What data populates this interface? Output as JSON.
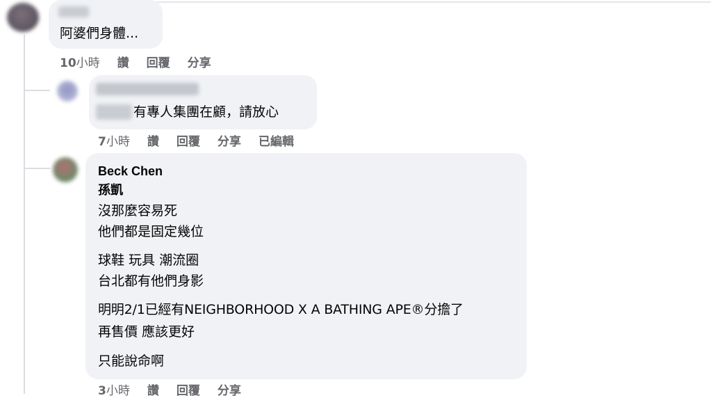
{
  "comments": [
    {
      "author_blurred": true,
      "text_lines": [
        "阿婆們身體..."
      ],
      "time_num": "10",
      "time_unit": "小時",
      "actions": [
        "讚",
        "回覆",
        "分享"
      ]
    },
    {
      "author_blurred": true,
      "mention_blurred": true,
      "text_lines": [
        "有專人集團在顧，請放心"
      ],
      "time_num": "7",
      "time_unit": "小時",
      "actions": [
        "讚",
        "回覆",
        "分享",
        "已編輯"
      ]
    },
    {
      "author": "Beck Chen",
      "mention": "孫凱",
      "text_lines": [
        "沒那麼容易死",
        "他們都是固定幾位",
        "球鞋 玩具 潮流圈",
        "台北都有他們身影",
        "明明2/1已經有NEIGHBORHOOD X A BATHING APE®分擔了",
        "再售價 應該更好",
        "只能說命啊"
      ],
      "time_num": "3",
      "time_unit": "小時",
      "actions": [
        "讚",
        "回覆",
        "分享"
      ]
    }
  ],
  "colors": {
    "bubble": "#f0f2f5",
    "meta_text": "#65676b",
    "thread_line": "#dadde1",
    "text": "#050505"
  }
}
